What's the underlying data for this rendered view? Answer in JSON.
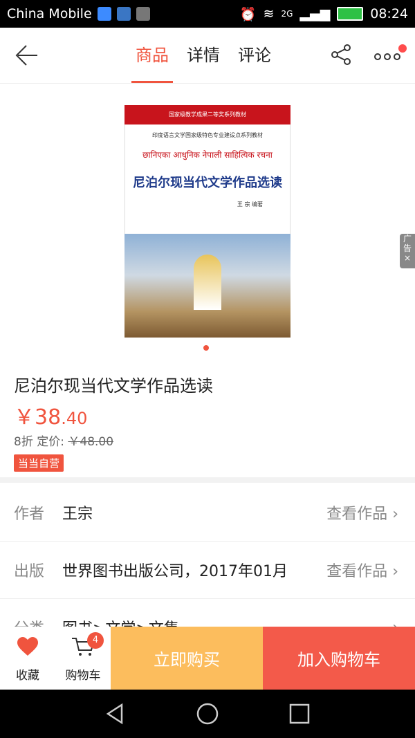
{
  "statusbar": {
    "carrier": "China Mobile",
    "network": "2G",
    "time": "08:24"
  },
  "navbar": {
    "tabs": [
      "商品",
      "详情",
      "评论"
    ],
    "active_tab": "商品"
  },
  "product": {
    "image_indicator": "1",
    "cover": {
      "series": "国家级教学成果二等奖系列教材",
      "subtitle": "印度语言文学国家级特色专业建设点系列教材",
      "script_title": "छानिएका आधुनिक नेपाली साहित्यिक रचना",
      "title": "尼泊尔现当代文学作品选读",
      "author": "王 宗 编著"
    },
    "title": "尼泊尔现当代文学作品选读",
    "price_main": "￥38",
    "price_decimal": ".40",
    "discount": "8折",
    "list_price_label": "定价:",
    "list_price": "￥48.00",
    "badge": "当当自营"
  },
  "ad": {
    "label": "广告",
    "close": "×"
  },
  "info_rows": [
    {
      "label": "作者",
      "value": "王宗",
      "link": "查看作品"
    },
    {
      "label": "出版",
      "value": "世界图书出版公司，2017年01月",
      "link": "查看作品"
    },
    {
      "label": "分类",
      "value": "图书>文学>文集",
      "link": ""
    }
  ],
  "bottom": {
    "favorite": "收藏",
    "cart": "购物车",
    "cart_count": "4",
    "buy_now": "立即购买",
    "add_to_cart": "加入购物车"
  },
  "colors": {
    "accent": "#f0543e",
    "buy": "#fcbd5d",
    "addcart": "#f35a4a"
  }
}
